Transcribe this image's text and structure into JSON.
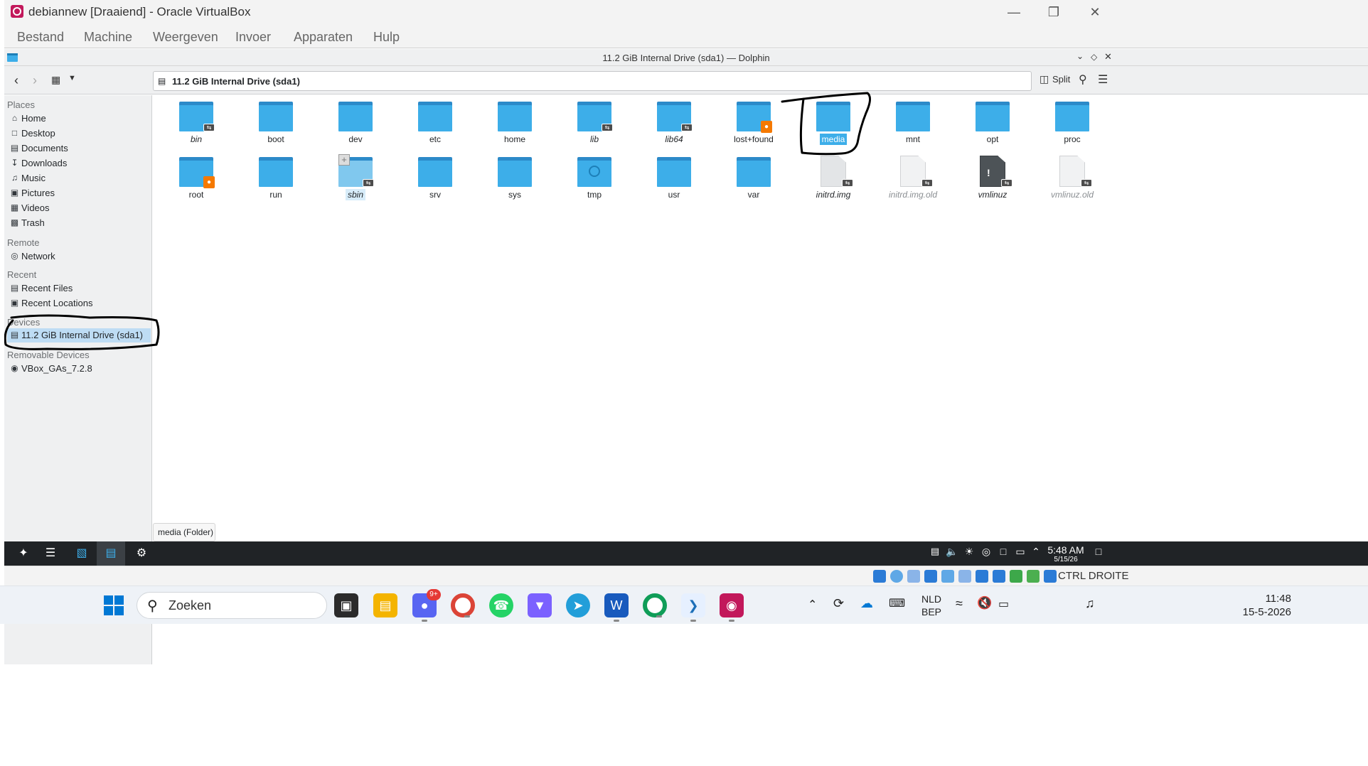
{
  "vbox": {
    "title": "debiannew [Draaiend] - Oracle VirtualBox",
    "menu": [
      "Bestand",
      "Machine",
      "Weergeven",
      "Invoer",
      "Apparaten",
      "Hulp"
    ],
    "hostkey": "CTRL DROITE"
  },
  "dolphin": {
    "window_title": "11.2 GiB Internal Drive (sda1) — Dolphin",
    "location": "11.2 GiB Internal Drive (sda1)",
    "split_label": "Split",
    "status": "media (Folder)"
  },
  "sidebar": {
    "places_label": "Places",
    "places": [
      "Home",
      "Desktop",
      "Documents",
      "Downloads",
      "Music",
      "Pictures",
      "Videos",
      "Trash"
    ],
    "remote_label": "Remote",
    "remote": [
      "Network"
    ],
    "recent_label": "Recent",
    "recent": [
      "Recent Files",
      "Recent Locations"
    ],
    "devices_label": "Devices",
    "devices": [
      "11.2 GiB Internal Drive (sda1)"
    ],
    "removable_label": "Removable Devices",
    "removable": [
      "VBox_GAs_7.2.8"
    ]
  },
  "files": {
    "row1": [
      "bin",
      "boot",
      "dev",
      "etc",
      "home",
      "lib",
      "lib64",
      "lost+found",
      "media",
      "mnt",
      "opt",
      "proc"
    ],
    "row2": [
      "root",
      "run",
      "sbin",
      "srv",
      "sys",
      "tmp",
      "usr",
      "var",
      "initrd.img",
      "initrd.img.old",
      "vmlinuz",
      "vmlinuz.old"
    ]
  },
  "guest_clock": {
    "time": "5:48 AM",
    "date": "5/15/26"
  },
  "taskbar": {
    "search_placeholder": "Zoeken",
    "lang": "NLD",
    "layout": "BEP",
    "time": "11:48",
    "date": "15-5-2026",
    "discord_badge": "9+"
  },
  "colors": {
    "folder": "#3daee9",
    "selection": "#3daee9",
    "sidebar_active": "#bedcf4"
  }
}
